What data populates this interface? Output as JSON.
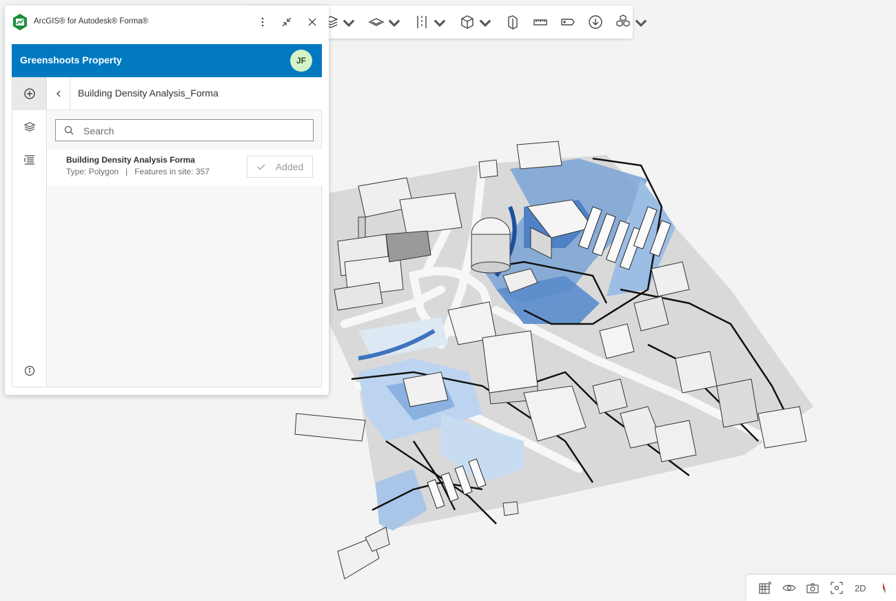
{
  "app": {
    "title": "ArcGIS® for Autodesk® Forma®",
    "brand_color": "#0079c1",
    "logo_icon": "arcgis-logo-icon"
  },
  "header": {
    "project_name": "Greenshoots Property",
    "avatar_initials": "JF"
  },
  "rail": {
    "items": [
      {
        "icon": "add-circle-icon",
        "active": true
      },
      {
        "icon": "layers-icon",
        "active": false
      },
      {
        "icon": "legend-icon",
        "active": false
      }
    ],
    "bottom_icon": "info-icon"
  },
  "content": {
    "title": "Building Density Analysis_Forma",
    "search": {
      "placeholder": "Search",
      "value": ""
    },
    "results": [
      {
        "name": "Building Density Analysis Forma",
        "type": "Type: Polygon",
        "features": "Features in site: 357",
        "action_label": "Added"
      }
    ]
  },
  "toolbar": {
    "icons": [
      "stack-icon",
      "plane-icon",
      "section-icon",
      "box-icon",
      "building-icon",
      "measure-icon",
      "tag-icon",
      "download-icon",
      "cubes-icon"
    ]
  },
  "view_toolbar": {
    "icons": [
      "grid-toggle-icon",
      "eye-icon",
      "camera-icon",
      "focus-icon"
    ],
    "mode_label": "2D",
    "compass_icon": "compass-icon"
  }
}
